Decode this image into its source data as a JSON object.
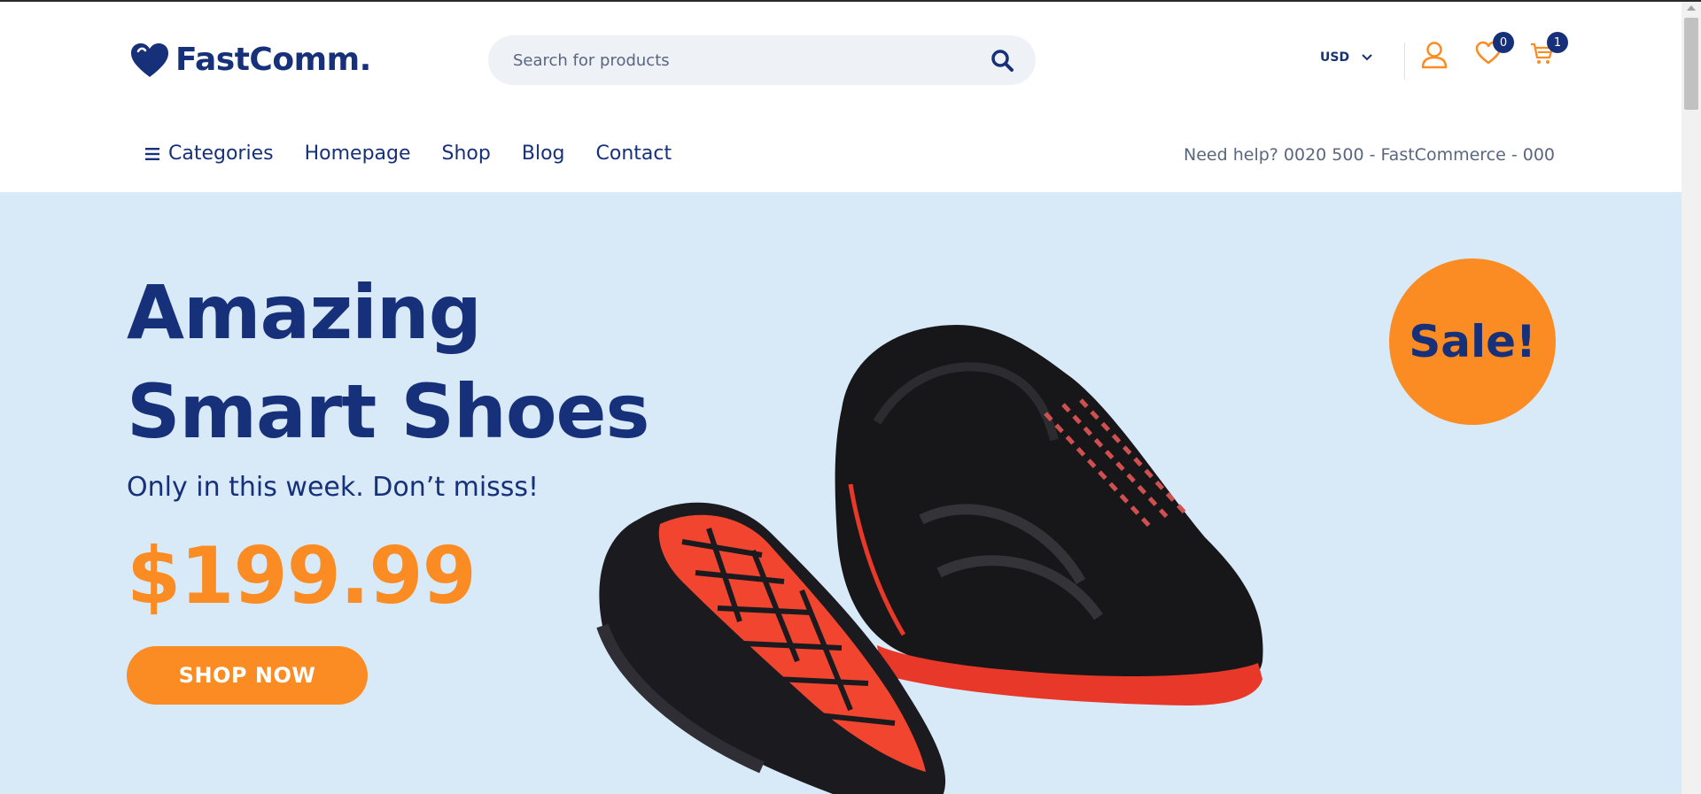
{
  "brand": {
    "name": "FastComm.",
    "color": "#17307a",
    "accent": "#fa8c23"
  },
  "search": {
    "placeholder": "Search for products",
    "icon": "search-icon"
  },
  "currency": {
    "selected": "USD"
  },
  "header_icons": {
    "account": "user-icon",
    "wishlist": {
      "icon": "heart-icon",
      "count": "0"
    },
    "cart": {
      "icon": "cart-icon",
      "count": "1"
    }
  },
  "nav": {
    "items": [
      {
        "label": "Categories",
        "icon": "menu-icon"
      },
      {
        "label": "Homepage"
      },
      {
        "label": "Shop"
      },
      {
        "label": "Blog"
      },
      {
        "label": "Contact"
      }
    ],
    "help_text": "Need help? 0020 500 - FastCommerce - 000"
  },
  "hero": {
    "title_line1": "Amazing",
    "title_line2": "Smart Shoes",
    "subtitle": "Only in this week. Don’t misss!",
    "price": "$199.99",
    "button_label": "SHOP NOW",
    "badge": "Sale!",
    "background": "#d8e9f8"
  }
}
